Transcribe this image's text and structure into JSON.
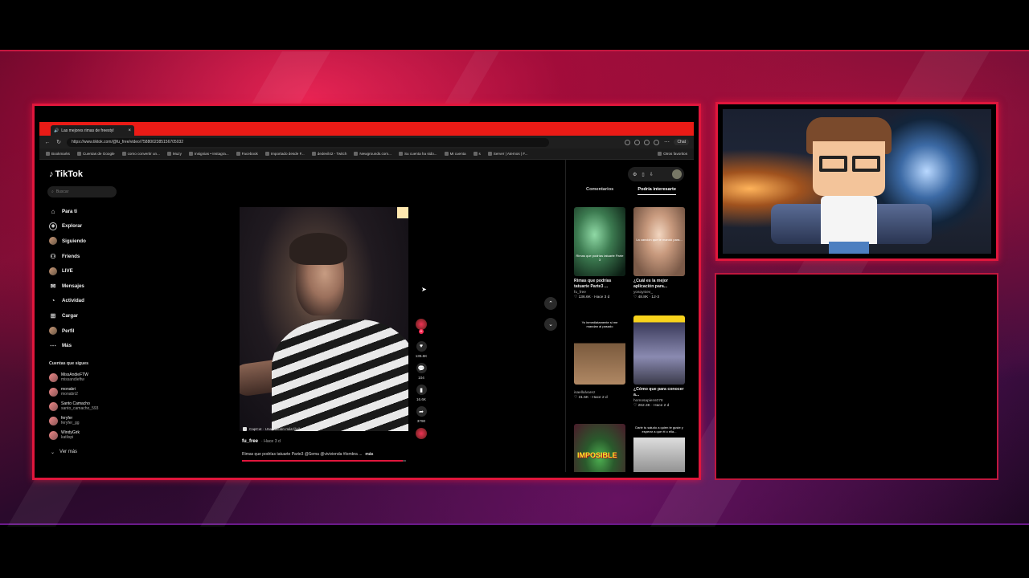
{
  "browser": {
    "tab_title": "Las mejores rimas de freestyl",
    "url": "https://www.tiktok.com/@fu_free/video/7588002385156705032",
    "chat_label": "Chat",
    "bookmarks": [
      "Bookmarks",
      "Cuentas de Google",
      "como convertir un...",
      "Muzy",
      "Insignias • Instagra...",
      "Facebook",
      "Importado desde F...",
      "dedevil42 - Twitch",
      "Newgrounds.com...",
      "Su cuenta ha sido...",
      "Mi cuenta",
      "s",
      "Server | Aternos | F..."
    ],
    "bookmarks_right": "Otros favoritos"
  },
  "sidebar": {
    "logo": "TikTok",
    "search_placeholder": "Buscar",
    "nav": [
      {
        "label": "Para ti",
        "icon": "home-icon"
      },
      {
        "label": "Explorar",
        "icon": "compass-icon"
      },
      {
        "label": "Siguiendo",
        "icon": "following-icon"
      },
      {
        "label": "Friends",
        "icon": "friends-icon"
      },
      {
        "label": "LIVE",
        "icon": "live-icon"
      },
      {
        "label": "Mensajes",
        "icon": "messages-icon"
      },
      {
        "label": "Actividad",
        "icon": "activity-icon"
      },
      {
        "label": "Cargar",
        "icon": "upload-icon"
      },
      {
        "label": "Perfil",
        "icon": "profile-icon"
      },
      {
        "label": "Más",
        "icon": "more-icon"
      }
    ],
    "following_title": "Cuentas que sigues",
    "following": [
      {
        "name": "MissAndieFTW",
        "user": "missandieftw"
      },
      {
        "name": "monabri",
        "user": "monabri2"
      },
      {
        "name": "Santo Camacho",
        "user": "santo_camacho_593"
      },
      {
        "name": "feryfer",
        "user": "feryfer_gg"
      },
      {
        "name": "WindyGirk",
        "user": "katlispi"
      }
    ],
    "see_more": "Ver más"
  },
  "video": {
    "capcut": "CapCut · Una edición más fácil",
    "author": "fu_free",
    "when": "· Hace 3 d",
    "caption": "Rimas que podrías tatuarte Parte3 @Sema @vivivienda #lombra ...",
    "more": "más",
    "progress": 0.98,
    "likes": "136.6K",
    "comments": "104",
    "saves": "16.6K",
    "shares": "3790"
  },
  "right_panel": {
    "tabs": [
      "Comentarios",
      "Podría interesarte"
    ],
    "active_tab": "Podría interesarte",
    "cards": [
      {
        "thumb_text": "Rimas que podrías tatuarte Parte 3",
        "title": "Rimas que podrías tatuarte Parte3 ...",
        "user": "fu_free",
        "meta": "♡ 136.6K · Hace 3 d"
      },
      {
        "thumb_text": "La canción que te mandó para...",
        "title": "¿Cuál es la mejor aplicación para...",
        "user": "yosoyniev_",
        "meta": "♡ 48.8K · 12-3"
      },
      {
        "thumb_text": "Yo inmediatamente si me mandan al pasado",
        "title": "",
        "user": "isaellalvarez",
        "meta": "♡ 31.5K · Hace 2 d"
      },
      {
        "thumb_text": "",
        "title": "¿Cómo que para conocer a...",
        "user": "homosapiens078",
        "meta": "♡ 262.3K · Hace 2 d"
      },
      {
        "thumb_text": "IMPOSIBLE",
        "title": "",
        "user": "",
        "meta": ""
      },
      {
        "thumb_text": "Darle tu saludo a quien te guste y esperar a que él o ella...",
        "title": "",
        "user": "",
        "meta": ""
      }
    ]
  },
  "colors": {
    "accent": "#e0163c",
    "tiktok_red": "#fe2c55",
    "tab_bar": "#ea1b16"
  }
}
